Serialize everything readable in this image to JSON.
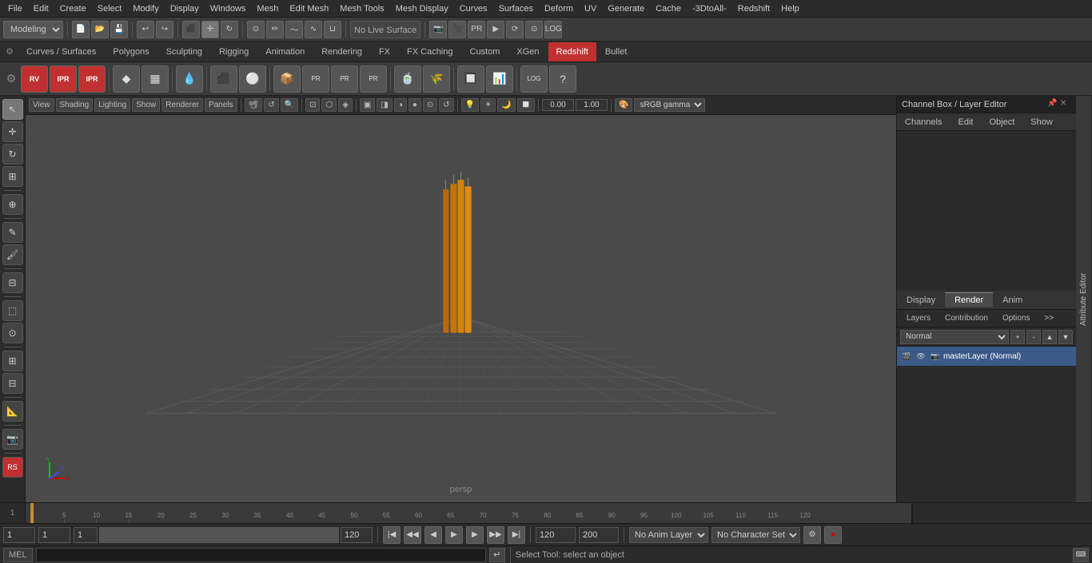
{
  "menuBar": {
    "items": [
      "File",
      "Edit",
      "Create",
      "Select",
      "Modify",
      "Display",
      "Windows",
      "Mesh",
      "Edit Mesh",
      "Mesh Tools",
      "Mesh Display",
      "Curves",
      "Surfaces",
      "Deform",
      "UV",
      "Generate",
      "Cache",
      "-3DtoAll-",
      "Redshift",
      "Help"
    ]
  },
  "toolbar1": {
    "mode": "Modeling",
    "noLiveLabel": "No Live Surface"
  },
  "tabs": {
    "items": [
      "Curves / Surfaces",
      "Polygons",
      "Sculpting",
      "Rigging",
      "Animation",
      "Rendering",
      "FX",
      "FX Caching",
      "Custom",
      "XGen",
      "Redshift",
      "Bullet"
    ],
    "active": "Redshift"
  },
  "viewport": {
    "label": "persp",
    "colorSpace": "sRGB gamma",
    "viewMenus": [
      "View",
      "Shading",
      "Lighting",
      "Show",
      "Renderer",
      "Panels"
    ]
  },
  "rightPanel": {
    "title": "Channel Box / Layer Editor",
    "headerTabs": [
      "Channels",
      "Edit",
      "Object",
      "Show"
    ],
    "renderTabs": [
      "Display",
      "Render",
      "Anim"
    ],
    "activeRenderTab": "Render",
    "layerTabs": [
      "Layers",
      "Contribution",
      "Options",
      ">>"
    ],
    "normalMode": "Normal",
    "layerRow": {
      "name": "masterLayer (Normal)"
    }
  },
  "attributeEditor": {
    "label": "Attribute Editor"
  },
  "bottomBar": {
    "frame1": "1",
    "frame2": "1",
    "frameInput": "1",
    "rangeStart": "120",
    "rangeEnd": "120",
    "maxRange": "200",
    "animLayer": "No Anim Layer",
    "charSet": "No Character Set"
  },
  "cmdBar": {
    "label": "MEL",
    "statusText": "Select Tool: select an object"
  },
  "timeline": {
    "ticks": [
      "1",
      "",
      "",
      "",
      "5",
      "",
      "",
      "",
      "",
      "10",
      "",
      "",
      "",
      "",
      "15",
      "",
      "",
      "",
      "",
      "20",
      "",
      "",
      "",
      "",
      "25",
      "",
      "",
      "",
      "",
      "30",
      "",
      "",
      "",
      "",
      "35",
      "",
      "",
      "",
      "",
      "40",
      "",
      "",
      "",
      "",
      "45",
      "",
      "",
      "",
      "",
      "50",
      "",
      "",
      "",
      "",
      "55",
      "",
      "",
      "",
      "",
      "60",
      "",
      "",
      "",
      "",
      "65",
      "",
      "",
      "",
      "",
      "70",
      "",
      "",
      "",
      "",
      "75",
      "",
      "",
      "",
      "",
      "80",
      "",
      "",
      "",
      "",
      "85",
      "",
      "",
      "",
      "",
      "90",
      "",
      "",
      "",
      "",
      "95",
      "",
      "",
      "",
      "",
      "100",
      "",
      "",
      "",
      "",
      "105",
      "",
      "",
      "",
      "",
      "110",
      "",
      "",
      "",
      "",
      "115",
      "",
      "",
      "",
      "",
      "120"
    ]
  }
}
